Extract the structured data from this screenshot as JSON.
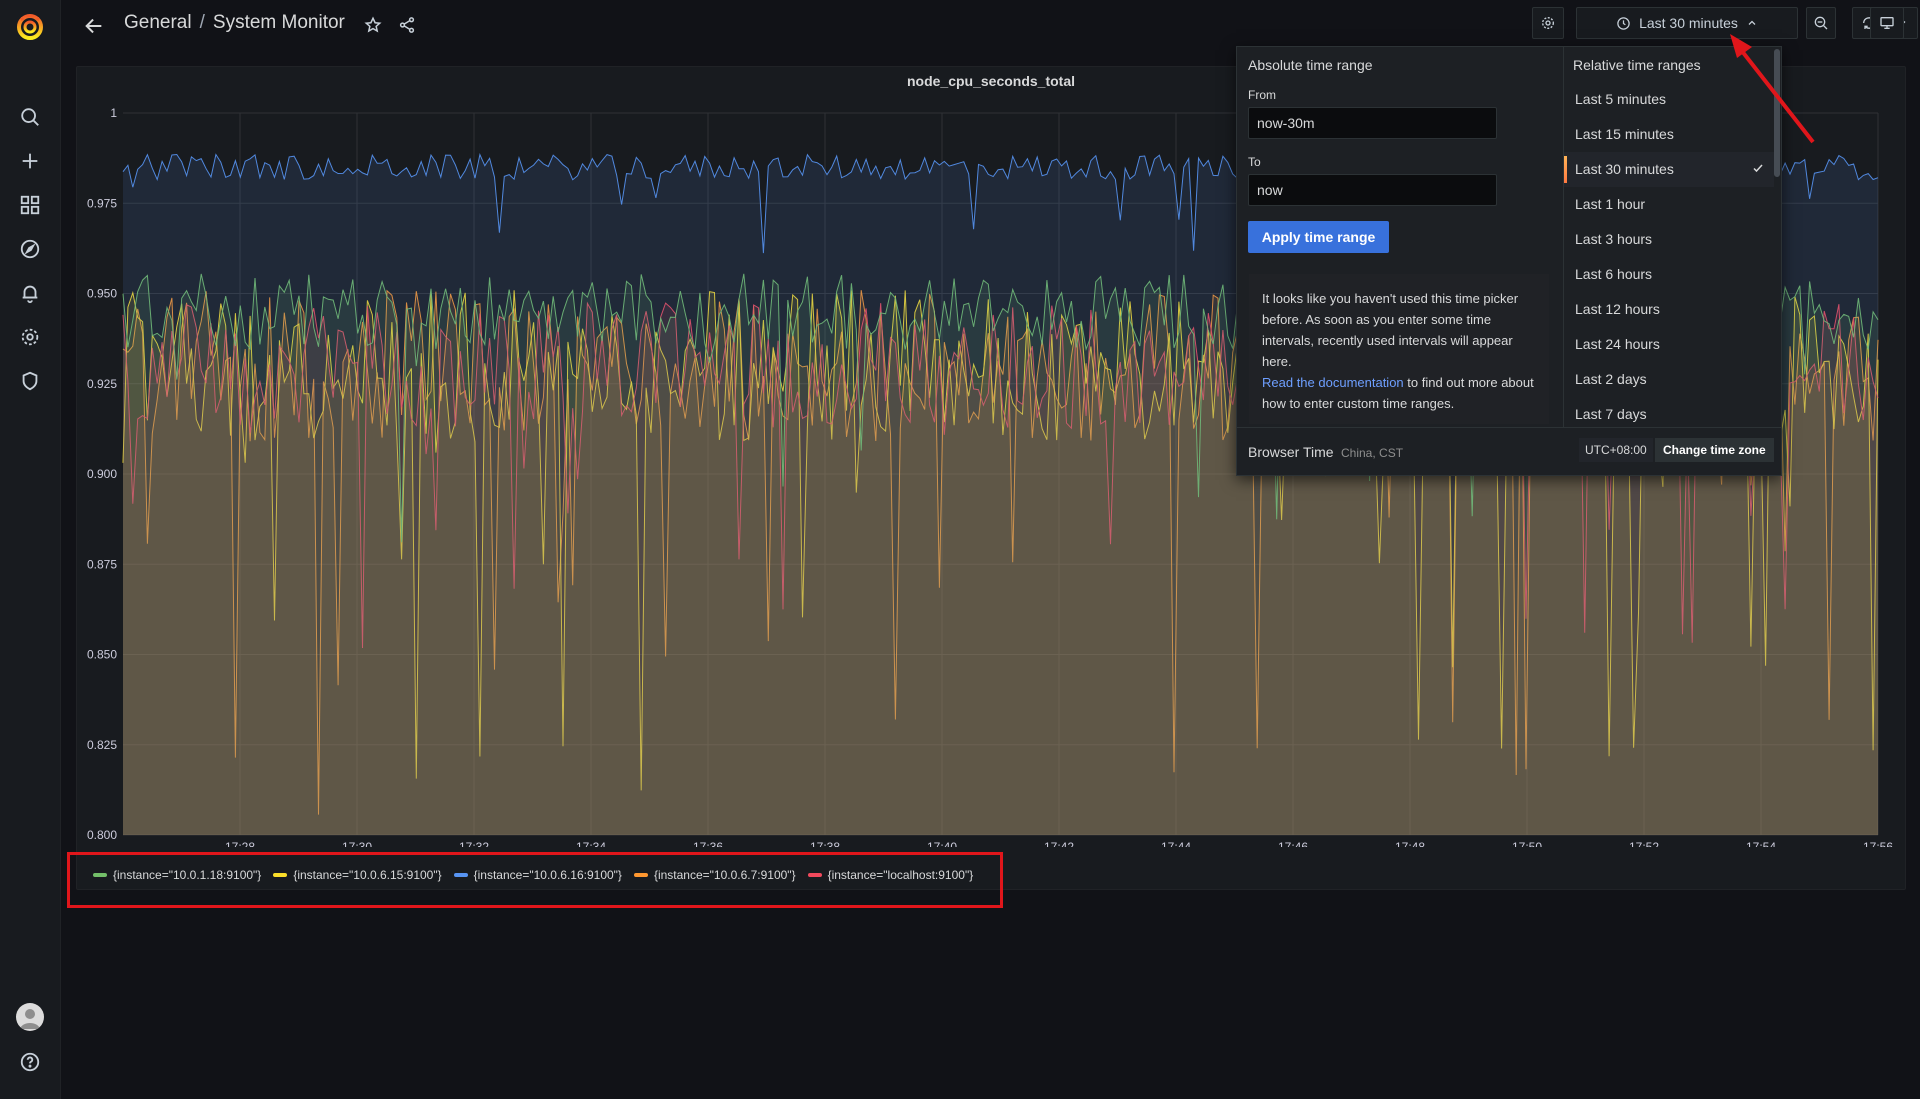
{
  "breadcrumb": {
    "folder": "General",
    "separator": "/",
    "dashboard": "System Monitor"
  },
  "toolbar": {
    "time_range_label": "Last 30 minutes"
  },
  "icons": {
    "sidebar": [
      "grafana-logo-icon",
      "search-icon",
      "plus-icon",
      "dashboards-icon",
      "explore-icon",
      "bell-icon",
      "gear-icon",
      "shield-icon",
      "avatar",
      "help-icon"
    ],
    "top": [
      "arrow-left-icon",
      "star-icon",
      "share-icon",
      "gear-icon",
      "clock-icon",
      "chevron-up-icon",
      "zoom-out-icon",
      "refresh-icon",
      "chevron-down-icon",
      "monitor-icon"
    ]
  },
  "colors": {
    "accent": "#3871dc",
    "annotation": "#e0161b",
    "link": "#6e9fff"
  },
  "panel": {
    "title": "node_cpu_seconds_total"
  },
  "chart_data": {
    "type": "line",
    "title": "node_cpu_seconds_total",
    "y_ticks": [
      "0.800",
      "0.825",
      "0.850",
      "0.875",
      "0.900",
      "0.925",
      "0.950",
      "0.975",
      "1"
    ],
    "ylim": [
      0.8,
      1.0
    ],
    "x_ticks": [
      "17:28",
      "17:30",
      "17:32",
      "17:34",
      "17:36",
      "17:38",
      "17:40",
      "17:42",
      "17:44",
      "17:46",
      "17:48",
      "17:50",
      "17:52",
      "17:54",
      "17:56"
    ],
    "xlim": [
      "17:26",
      "17:56"
    ],
    "grid": true,
    "fill": "area",
    "legend_position": "bottom-left",
    "series": [
      {
        "name": "{instance=\"10.0.1.18:9100\"}",
        "color": "#73bf69",
        "mean": 0.945,
        "min": 0.87,
        "max": 0.96
      },
      {
        "name": "{instance=\"10.0.6.15:9100\"}",
        "color": "#fade2a",
        "mean": 0.93,
        "min": 0.805,
        "max": 0.96
      },
      {
        "name": "{instance=\"10.0.6.16:9100\"}",
        "color": "#5794f2",
        "mean": 0.985,
        "min": 0.96,
        "max": 0.99
      },
      {
        "name": "{instance=\"10.0.6.7:9100\"}",
        "color": "#ff9830",
        "mean": 0.93,
        "min": 0.805,
        "max": 0.96
      },
      {
        "name": "{instance=\"localhost:9100\"}",
        "color": "#f2495c",
        "mean": 0.93,
        "min": 0.85,
        "max": 0.955
      }
    ]
  },
  "time_picker": {
    "absolute_title": "Absolute time range",
    "from_label": "From",
    "from_value": "now-30m",
    "to_label": "To",
    "to_value": "now",
    "apply_label": "Apply time range",
    "note_text": "It looks like you haven't used this time picker before. As soon as you enter some time intervals, recently used intervals will appear here.",
    "note_link": "Read the documentation",
    "note_after": " to find out more about how to enter custom time ranges.",
    "relative_title": "Relative time ranges",
    "relative_options": [
      "Last 5 minutes",
      "Last 15 minutes",
      "Last 30 minutes",
      "Last 1 hour",
      "Last 3 hours",
      "Last 6 hours",
      "Last 12 hours",
      "Last 24 hours",
      "Last 2 days",
      "Last 7 days"
    ],
    "selected_option": "Last 30 minutes",
    "browser_time_label": "Browser Time",
    "timezone_name": "China, CST",
    "utc_offset": "UTC+08:00",
    "change_tz_label": "Change time zone"
  }
}
